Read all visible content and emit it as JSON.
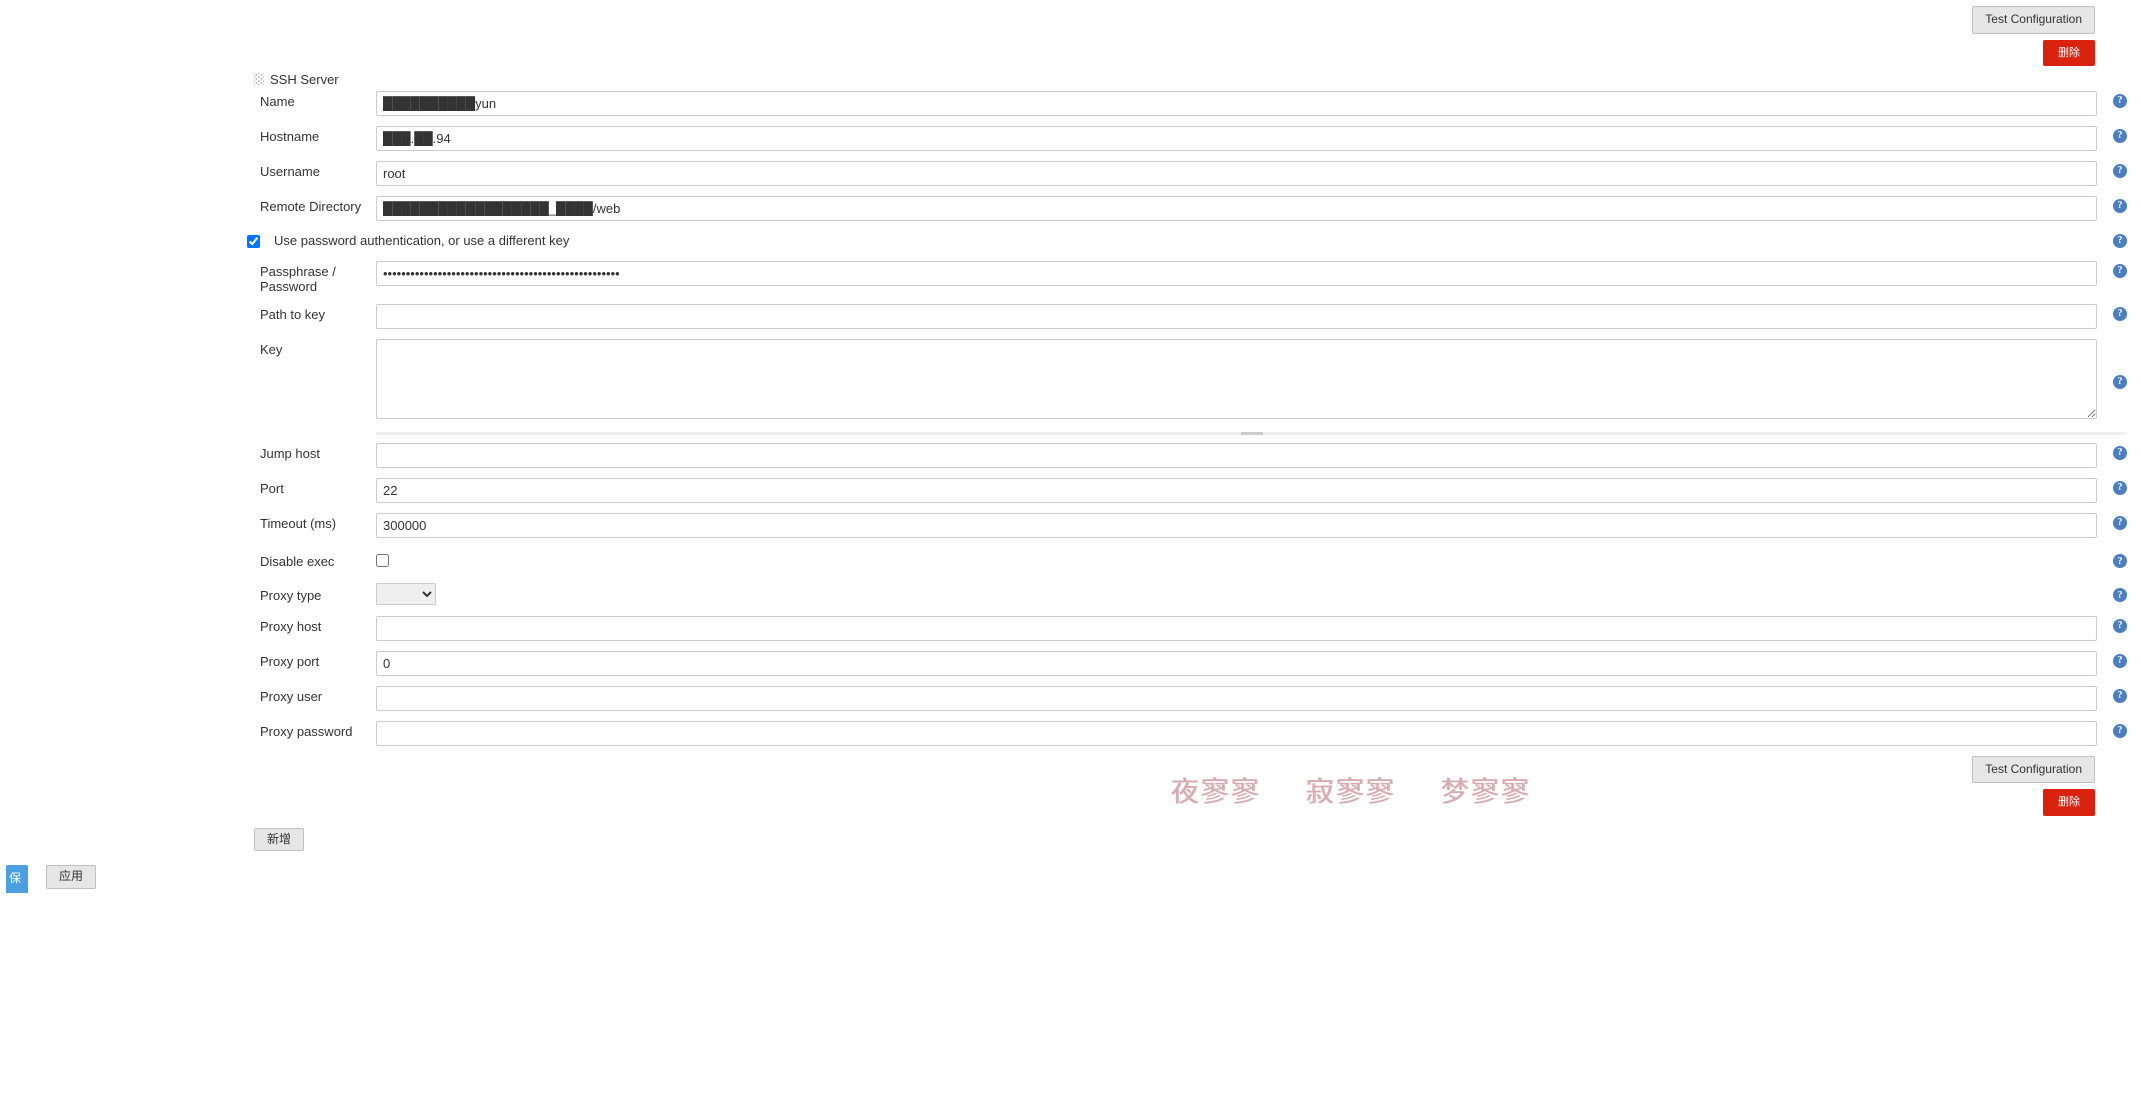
{
  "buttons": {
    "test_config": "Test Configuration",
    "delete": "删除",
    "add": "新增",
    "apply": "应用",
    "save_edge": "保"
  },
  "section": {
    "title": "SSH Server"
  },
  "fields": {
    "name": {
      "label": "Name",
      "value": "██████████yun"
    },
    "hostname": {
      "label": "Hostname",
      "value": "███.██.94"
    },
    "username": {
      "label": "Username",
      "value": "root"
    },
    "remote_dir": {
      "label": "Remote Directory",
      "value": "██████████████████_████/web"
    },
    "use_password_auth": {
      "label": "Use password authentication, or use a different key",
      "checked": true
    },
    "passphrase": {
      "label": "Passphrase / Password",
      "value": "••••••••••••••••••••••••••••••••••••••••••••••••••••"
    },
    "path_to_key": {
      "label": "Path to key",
      "value": ""
    },
    "key": {
      "label": "Key",
      "value": ""
    },
    "jump_host": {
      "label": "Jump host",
      "value": ""
    },
    "port": {
      "label": "Port",
      "value": "22"
    },
    "timeout": {
      "label": "Timeout (ms)",
      "value": "300000"
    },
    "disable_exec": {
      "label": "Disable exec",
      "checked": false
    },
    "proxy_type": {
      "label": "Proxy type",
      "value": ""
    },
    "proxy_host": {
      "label": "Proxy host",
      "value": ""
    },
    "proxy_port": {
      "label": "Proxy port",
      "value": "0"
    },
    "proxy_user": {
      "label": "Proxy user",
      "value": ""
    },
    "proxy_password": {
      "label": "Proxy password",
      "value": ""
    }
  },
  "watermark": [
    "夜寥寥",
    "寂寥寥",
    "梦寥寥"
  ]
}
